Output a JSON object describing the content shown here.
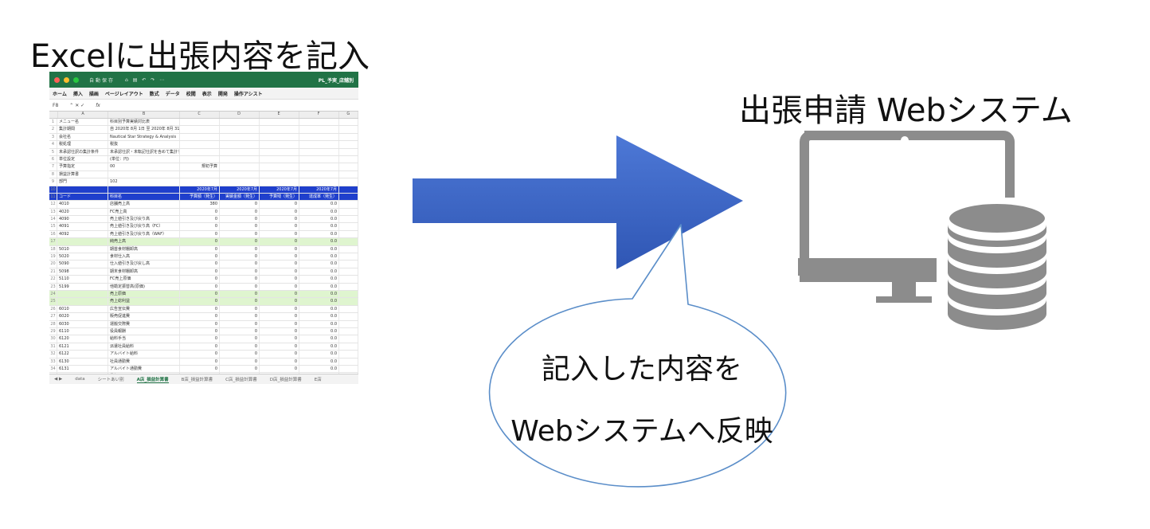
{
  "title_left": "Excelに出張内容を記入",
  "title_right": "出張申請 Webシステム",
  "bubble": {
    "line1": "記入した内容を",
    "line2": "Webシステムへ反映"
  },
  "colors": {
    "arrow": "#3f68c8",
    "monitor": "#8c8c8c",
    "excel_green": "#217346",
    "excel_header_blue": "#1f3fcc",
    "subtotal_green": "#dff5cf",
    "bubble_stroke": "#5b8ec9"
  },
  "icons": [
    "right-arrow-icon",
    "monitor-icon",
    "database-icon",
    "speech-bubble"
  ],
  "excel": {
    "qa_label": "自動保存",
    "file_name": "PL_予実_店舗別",
    "ribbon": [
      "ホーム",
      "挿入",
      "描画",
      "ページレイアウト",
      "数式",
      "データ",
      "校閲",
      "表示",
      "開発",
      "操作アシスト"
    ],
    "cell_ref": "F8",
    "fx": "fx",
    "col_headers": [
      "",
      "A",
      "B",
      "C",
      "D",
      "E",
      "F",
      "G"
    ],
    "rows": [
      {
        "n": "1",
        "cells": [
          "メニュー名",
          "科目別予算実績対比表",
          "",
          "",
          "",
          ""
        ],
        "style": ""
      },
      {
        "n": "2",
        "cells": [
          "集計期間",
          "自 2020年 8月 1日 至 2020年 8月 31日",
          "",
          "",
          "",
          ""
        ],
        "style": ""
      },
      {
        "n": "3",
        "cells": [
          "会社名",
          "Nautical Star Strategy & Analysis",
          "",
          "",
          "",
          ""
        ],
        "style": ""
      },
      {
        "n": "4",
        "cells": [
          "税処理",
          "税抜",
          "",
          "",
          "",
          ""
        ],
        "style": ""
      },
      {
        "n": "5",
        "cells": [
          "未承認仕訳の集計条件",
          "未承認仕訳・未転記仕訳を含めて集計する",
          "",
          "",
          "",
          ""
        ],
        "style": ""
      },
      {
        "n": "6",
        "cells": [
          "単位設定",
          "(単位：円)",
          "",
          "",
          "",
          ""
        ],
        "style": ""
      },
      {
        "n": "7",
        "cells": [
          "予算指定",
          "00",
          "規初予算",
          "",
          "",
          ""
        ],
        "style": ""
      },
      {
        "n": "8",
        "cells": [
          "損益計算書",
          "",
          "",
          "",
          "",
          ""
        ],
        "style": ""
      },
      {
        "n": "9",
        "cells": [
          "部門",
          "102",
          "",
          "",
          "",
          ""
        ],
        "style": ""
      },
      {
        "n": "10",
        "cells": [
          "",
          "",
          "2020年7月",
          "2020年7月",
          "2020年7月",
          "2020年7月"
        ],
        "style": "blue"
      },
      {
        "n": "11",
        "cells": [
          "コード",
          "科目名",
          "予算額（発生）",
          "実績金額（発生）",
          "予算残（発生）",
          "達成率（発生）"
        ],
        "style": "blue"
      },
      {
        "n": "12",
        "cells": [
          "4010",
          "店舗売上高",
          "380",
          "0",
          "0",
          "0.0"
        ],
        "style": ""
      },
      {
        "n": "13",
        "cells": [
          "4020",
          "FC売上高",
          "0",
          "0",
          "0",
          "0.0"
        ],
        "style": ""
      },
      {
        "n": "14",
        "cells": [
          "4090",
          "売上値引き及び戻り高",
          "0",
          "0",
          "0",
          "0.0"
        ],
        "style": ""
      },
      {
        "n": "15",
        "cells": [
          "4091",
          "売上値引き及び戻り高（FC）",
          "0",
          "0",
          "0",
          "0.0"
        ],
        "style": ""
      },
      {
        "n": "16",
        "cells": [
          "4092",
          "売上値引き及び戻り高（WAF）",
          "0",
          "0",
          "0",
          "0.0"
        ],
        "style": ""
      },
      {
        "n": "17",
        "cells": [
          "",
          "純売上高",
          "0",
          "0",
          "0",
          "0.0"
        ],
        "style": "green"
      },
      {
        "n": "18",
        "cells": [
          "5010",
          "期首食材棚卸高",
          "0",
          "0",
          "0",
          "0.0"
        ],
        "style": ""
      },
      {
        "n": "19",
        "cells": [
          "5020",
          "食材仕入高",
          "0",
          "0",
          "0",
          "0.0"
        ],
        "style": ""
      },
      {
        "n": "20",
        "cells": [
          "5090",
          "仕入値引き及び戻し高",
          "0",
          "0",
          "0",
          "0.0"
        ],
        "style": ""
      },
      {
        "n": "21",
        "cells": [
          "5098",
          "期末食材棚卸高",
          "0",
          "0",
          "0",
          "0.0"
        ],
        "style": ""
      },
      {
        "n": "22",
        "cells": [
          "5110",
          "FC売上原価",
          "0",
          "0",
          "0",
          "0.0"
        ],
        "style": ""
      },
      {
        "n": "23",
        "cells": [
          "5199",
          "他勘定振替高(原価)",
          "0",
          "0",
          "0",
          "0.0"
        ],
        "style": ""
      },
      {
        "n": "24",
        "cells": [
          "",
          "売上原価",
          "0",
          "0",
          "0",
          "0.0"
        ],
        "style": "green"
      },
      {
        "n": "25",
        "cells": [
          "",
          "売上総利益",
          "0",
          "0",
          "0",
          "0.0"
        ],
        "style": "green"
      },
      {
        "n": "26",
        "cells": [
          "6010",
          "広告宣伝費",
          "0",
          "0",
          "0",
          "0.0"
        ],
        "style": ""
      },
      {
        "n": "27",
        "cells": [
          "6020",
          "販売促進費",
          "0",
          "0",
          "0",
          "0.0"
        ],
        "style": ""
      },
      {
        "n": "28",
        "cells": [
          "6030",
          "運搬交際費",
          "0",
          "0",
          "0",
          "0.0"
        ],
        "style": ""
      },
      {
        "n": "29",
        "cells": [
          "6110",
          "役員報酬",
          "0",
          "0",
          "0",
          "0.0"
        ],
        "style": ""
      },
      {
        "n": "30",
        "cells": [
          "6120",
          "給料手当",
          "0",
          "0",
          "0",
          "0.0"
        ],
        "style": ""
      },
      {
        "n": "31",
        "cells": [
          "6121",
          "派遣社員給料",
          "0",
          "0",
          "0",
          "0.0"
        ],
        "style": ""
      },
      {
        "n": "32",
        "cells": [
          "6122",
          "アルバイト給料",
          "0",
          "0",
          "0",
          "0.0"
        ],
        "style": ""
      },
      {
        "n": "33",
        "cells": [
          "6130",
          "社員通勤費",
          "0",
          "0",
          "0",
          "0.0"
        ],
        "style": ""
      },
      {
        "n": "34",
        "cells": [
          "6131",
          "アルバイト通勤費",
          "0",
          "0",
          "0",
          "0.0"
        ],
        "style": ""
      },
      {
        "n": "35",
        "cells": [
          "6140",
          "賞与",
          "0",
          "0",
          "0",
          "0.0"
        ],
        "style": ""
      }
    ],
    "sheet_tabs": [
      "data",
      "シートあい別",
      "A店_損益計算書",
      "B店_損益計算書",
      "C店_損益計算書",
      "D店_損益計算書",
      "E店"
    ]
  }
}
